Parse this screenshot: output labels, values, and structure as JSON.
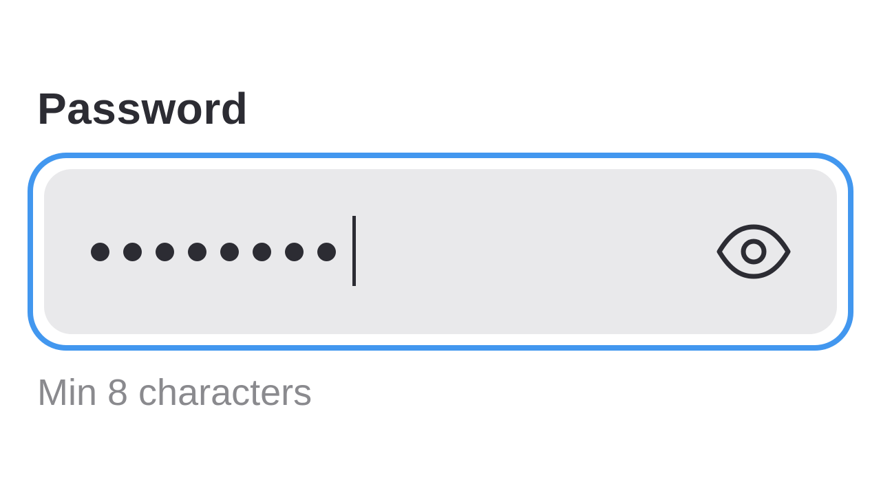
{
  "password_field": {
    "label": "Password",
    "value_masked": "••••••••",
    "masked_char_count": 8,
    "focused": true,
    "focus_ring_color": "#4297ef",
    "toggle_icon": "eye-icon",
    "hint": "Min 8 characters"
  }
}
